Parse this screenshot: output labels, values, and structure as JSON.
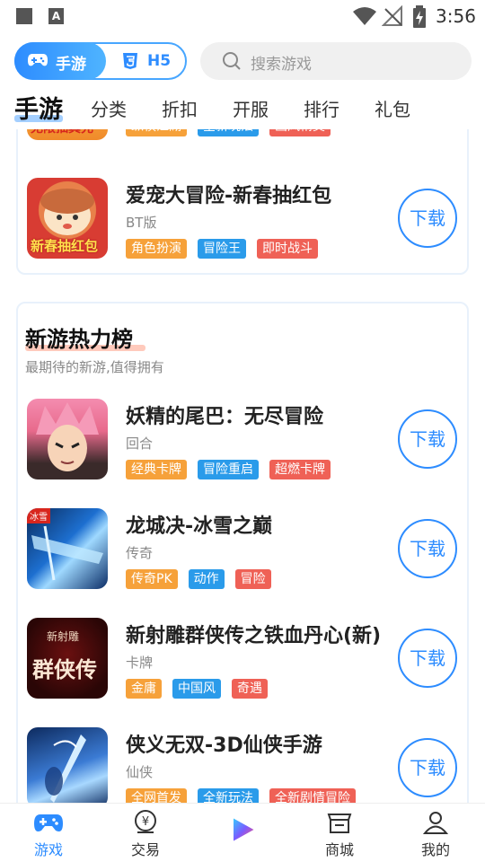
{
  "status_bar": {
    "a_label": "A",
    "time": "3:56"
  },
  "header": {
    "segment": [
      {
        "label": "手游",
        "icon": "gamepad-icon"
      },
      {
        "label": "H5",
        "icon": "html5-icon"
      }
    ],
    "search": {
      "placeholder": "搜索游戏",
      "icon": "search-icon"
    }
  },
  "tabs": [
    "手游",
    "分类",
    "折扣",
    "开服",
    "排行",
    "礼包"
  ],
  "top_card": {
    "partial_tags": [
      "纵横江湖",
      "全新玩法",
      "画风精美"
    ],
    "partial_icon_text": "无限抽真充",
    "game": {
      "name": "爱宠大冒险-新春抽红包",
      "subtitle": "BT版",
      "tags": [
        "角色扮演",
        "冒险王",
        "即时战斗"
      ],
      "icon_text": "新春抽红包",
      "download_label": "下载"
    }
  },
  "section": {
    "title": "新游热力榜",
    "subtitle": "最期待的新游,值得拥有",
    "games": [
      {
        "name": "妖精的尾巴：无尽冒险",
        "subtitle": "回合",
        "tags": [
          "经典卡牌",
          "冒险重启",
          "超燃卡牌"
        ],
        "download_label": "下载"
      },
      {
        "name": "龙城决-冰雪之巅",
        "subtitle": "传奇",
        "tags": [
          "传奇PK",
          "动作",
          "冒险"
        ],
        "icon_text": "冰雪",
        "download_label": "下载"
      },
      {
        "name": "新射雕群侠传之铁血丹心(新)",
        "subtitle": "卡牌",
        "tags": [
          "金庸",
          "中国风",
          "奇遇"
        ],
        "icon_text": "群侠传",
        "icon_text_top": "新射雕",
        "download_label": "下载"
      },
      {
        "name": "侠义无双-3D仙侠手游",
        "subtitle": "仙侠",
        "tags": [
          "全网首发",
          "全新玩法",
          "全新剧情冒险"
        ],
        "download_label": "下载"
      }
    ]
  },
  "bottom_nav": [
    {
      "label": "游戏",
      "icon": "gamepad-icon",
      "active": true
    },
    {
      "label": "交易",
      "icon": "trade-icon",
      "active": false
    },
    {
      "label": "",
      "icon": "play-logo-icon",
      "active": false
    },
    {
      "label": "商城",
      "icon": "store-icon",
      "active": false
    },
    {
      "label": "我的",
      "icon": "profile-icon",
      "active": false
    }
  ],
  "colors": {
    "accent": "#2d8cff",
    "tag_orange": "#f6a13a",
    "tag_blue": "#2a9bea",
    "tag_red": "#ef6156"
  }
}
